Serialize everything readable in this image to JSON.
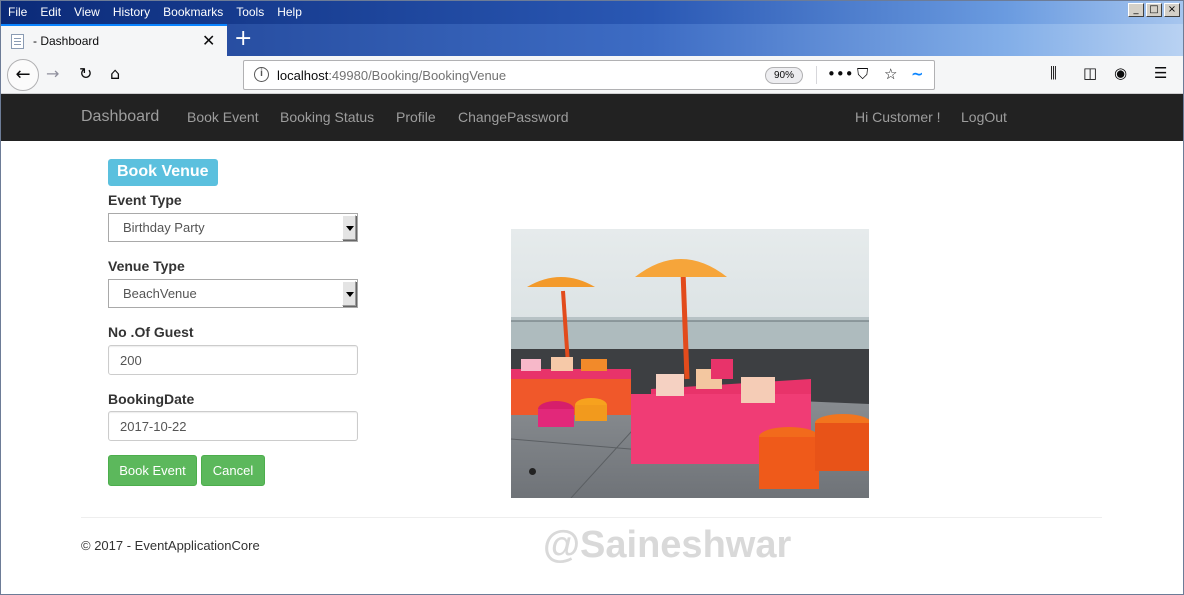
{
  "browser": {
    "menu": [
      "File",
      "Edit",
      "View",
      "History",
      "Bookmarks",
      "Tools",
      "Help"
    ],
    "tab_title": "- Dashboard",
    "url_host": "localhost",
    "url_rest": ":49980/Booking/BookingVenue",
    "zoom": "90%",
    "icons": [
      "back-icon",
      "forward-icon",
      "reload-icon",
      "home-icon",
      "info-icon",
      "more-icon",
      "pocket-icon",
      "bookmark-star-icon",
      "extension-icon",
      "library-icon",
      "sidebar-icon",
      "account-icon",
      "hamburger-menu-icon"
    ]
  },
  "site_nav": {
    "brand": "Dashboard",
    "links": [
      "Book Event",
      "Booking Status",
      "Profile",
      "ChangePassword"
    ],
    "greeting": "Hi Customer !",
    "logout": "LogOut",
    "background": "#222222"
  },
  "form": {
    "panel_title": "Book Venue",
    "event_type_label": "Event Type",
    "event_type_value": "Birthday Party",
    "venue_type_label": "Venue Type",
    "venue_type_value": "BeachVenue",
    "guests_label": "No .Of Guest",
    "guests_value": "200",
    "date_label": "BookingDate",
    "date_value": "2017-10-22",
    "submit_label": "Book Event",
    "cancel_label": "Cancel",
    "accent": "#5bc0de",
    "button_color": "#5cb85c"
  },
  "carousel": {
    "image": "rooftop-venue-photo",
    "active_slide": 1
  },
  "footer": {
    "copyright": "© 2017 - EventApplicationCore",
    "watermark": "@Saineshwar"
  }
}
